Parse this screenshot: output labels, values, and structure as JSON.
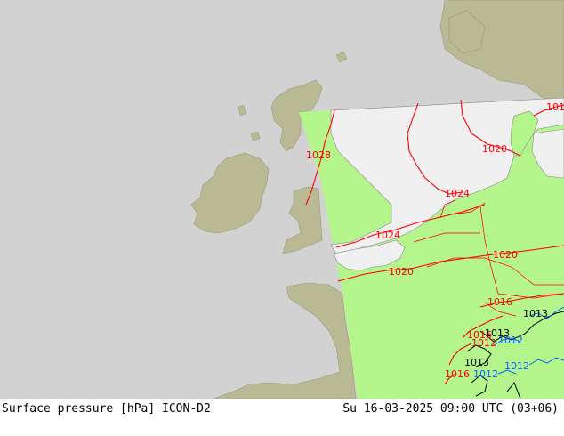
{
  "title_left": "Surface pressure [hPa] ICON-D2",
  "title_right": "Su 16-03-2025 09:00 UTC (03+06)",
  "colors": {
    "background": "#d2d2d2",
    "land_outside": "#b9b994",
    "domain_land": "#b4f58c",
    "domain_sea": "#f0f0f0",
    "isobar_red": "#ff0000",
    "isobar_black": "#000000",
    "isobar_blue": "#0064ff",
    "border_line": "#ff0000"
  },
  "isobar_labels": {
    "red": [
      "1028",
      "1024",
      "1024",
      "1020",
      "1020",
      "1020",
      "1016",
      "1016",
      "1016",
      "1016",
      "1012"
    ],
    "black": [
      "1013",
      "1013",
      "1013"
    ],
    "blue": [
      "1012",
      "1012",
      "1012"
    ]
  }
}
